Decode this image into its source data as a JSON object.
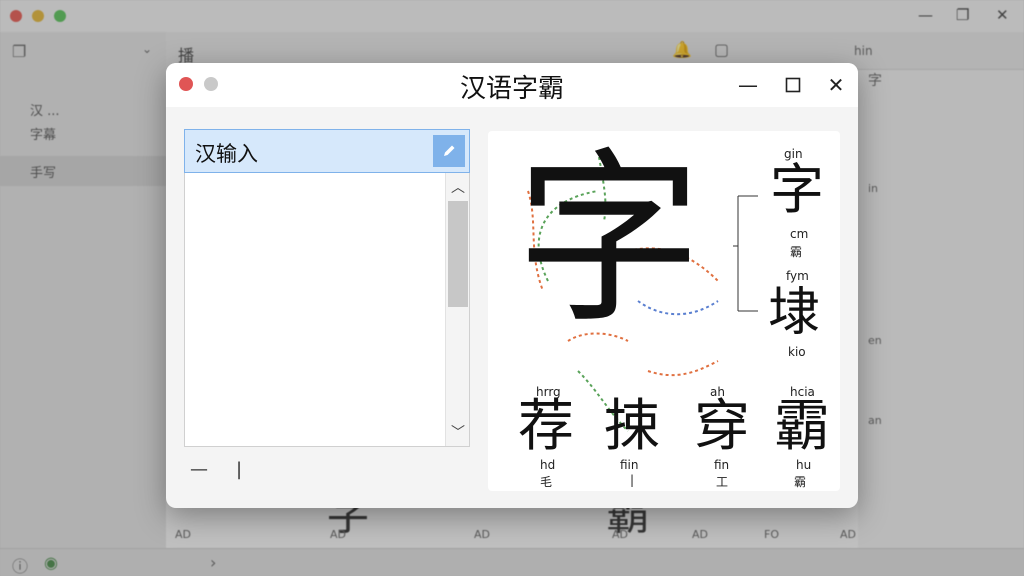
{
  "dialog": {
    "title": "汉语字霸",
    "input_value": "汉输入",
    "bottom_dash": "—",
    "bottom_cursor": "|"
  },
  "illustration": {
    "main_char": "字",
    "side_top": {
      "pinyin": "gin",
      "char": "字",
      "label1": "cm",
      "label2": "霸"
    },
    "side_bottom": {
      "pinyin": "fym",
      "char": "埭",
      "label1": "kio"
    },
    "row": [
      {
        "pinyin": "hrrg",
        "char": "荐",
        "bottom_pinyin": "hd",
        "bottom_char": "毛"
      },
      {
        "pinyin": "",
        "char": "捒",
        "bottom_pinyin": "fiin",
        "bottom_char": "|"
      },
      {
        "pinyin": "ah",
        "char": "穿",
        "bottom_pinyin": "fin",
        "bottom_char": "工"
      },
      {
        "pinyin": "hcia",
        "char": "霸",
        "bottom_pinyin": "hu",
        "bottom_char": "霸"
      }
    ]
  },
  "background": {
    "toolbar_char": "播",
    "toolbar_right": "hin",
    "sidebar_items": [
      "汉 ...",
      "字幕",
      "手写"
    ],
    "status_labels": [
      "AD",
      "AD",
      "AD",
      "AD",
      "AD",
      "FO",
      "AD"
    ],
    "right_labels": [
      "字",
      "in",
      "en",
      "an"
    ]
  },
  "colors": {
    "accent": "#7fb2ea",
    "input_bg": "#d6e8fb",
    "close_dot": "#e05555"
  }
}
